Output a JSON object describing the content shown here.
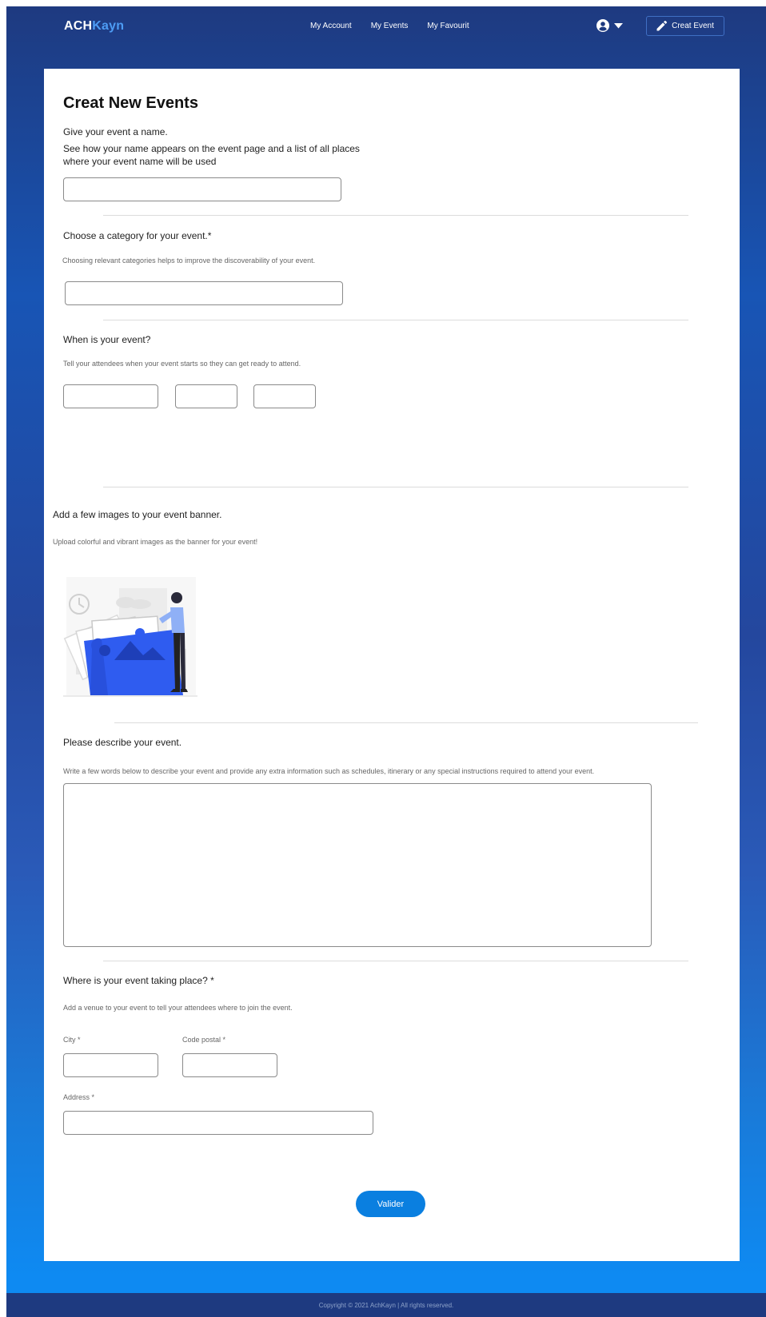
{
  "header": {
    "logo_part1": "ACH",
    "logo_part2": "Kayn",
    "nav": [
      "My Account",
      "My Events",
      "My Favourit"
    ],
    "create_event_label": "Creat Event"
  },
  "form": {
    "title": "Creat New Events",
    "name_section": {
      "question": "Give your event a name.",
      "help": "See how your name appears on the event page and a list of all places where your event name will be used",
      "value": ""
    },
    "category_section": {
      "question": "Choose a category for your event.*",
      "help": "Choosing relevant categories helps to improve the discoverability of your event.",
      "value": ""
    },
    "date_section": {
      "question": "When is your event?",
      "help": "Tell your attendees when your event starts so they can get ready to attend."
    },
    "banner_section": {
      "question": "Add a few images to your event banner.",
      "help": "Upload colorful and vibrant images as the banner for your event!"
    },
    "description_section": {
      "question": "Please describe your event.",
      "help": "Write a few words below to describe your event and provide any extra information such as schedules, itinerary or any special instructions required to attend your event."
    },
    "location_section": {
      "question": "Where is your event taking place? *",
      "help": "Add a venue to your event to tell your attendees where to join the event.",
      "city_label": "City *",
      "postal_label": "Code postal *",
      "address_label": "Address *"
    },
    "submit_label": "Valider"
  },
  "footer": {
    "copyright": "Copyright © 2021 AchKayn | All rights reserved."
  },
  "colors": {
    "header_bg": "#1e3a80",
    "accent": "#4d9cf4",
    "button": "#0a7fe0",
    "illustration": "#2f5cf0"
  }
}
